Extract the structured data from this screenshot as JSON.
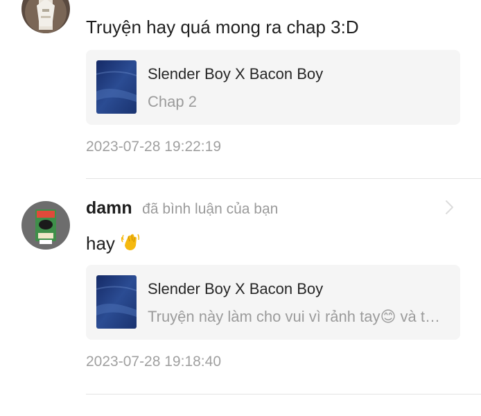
{
  "notifications": [
    {
      "username": "",
      "action": "",
      "comment": "Truyện hay quá mong ra chap 3:D",
      "story": {
        "title": "Slender Boy X Bacon Boy",
        "subtitle": "Chap 2"
      },
      "timestamp": "2023-07-28 19:22:19",
      "avatar_icon": "anime-character-avatar"
    },
    {
      "username": "damn",
      "action": "đã bình luận của bạn",
      "comment": "hay",
      "comment_emoji": "waving-hand-icon",
      "story": {
        "title": "Slender Boy X Bacon Boy",
        "subtitle": "Truyện này làm cho vui vì rảnh tay😊 và tôi thích Slender Boy"
      },
      "timestamp": "2023-07-28 19:18:40",
      "avatar_icon": "product-box-avatar"
    }
  ],
  "colors": {
    "card_bg": "#f5f5f5",
    "divider": "#e3e3e3",
    "muted_text": "#9b9b9b",
    "cover_blue": "#1e3a78"
  }
}
